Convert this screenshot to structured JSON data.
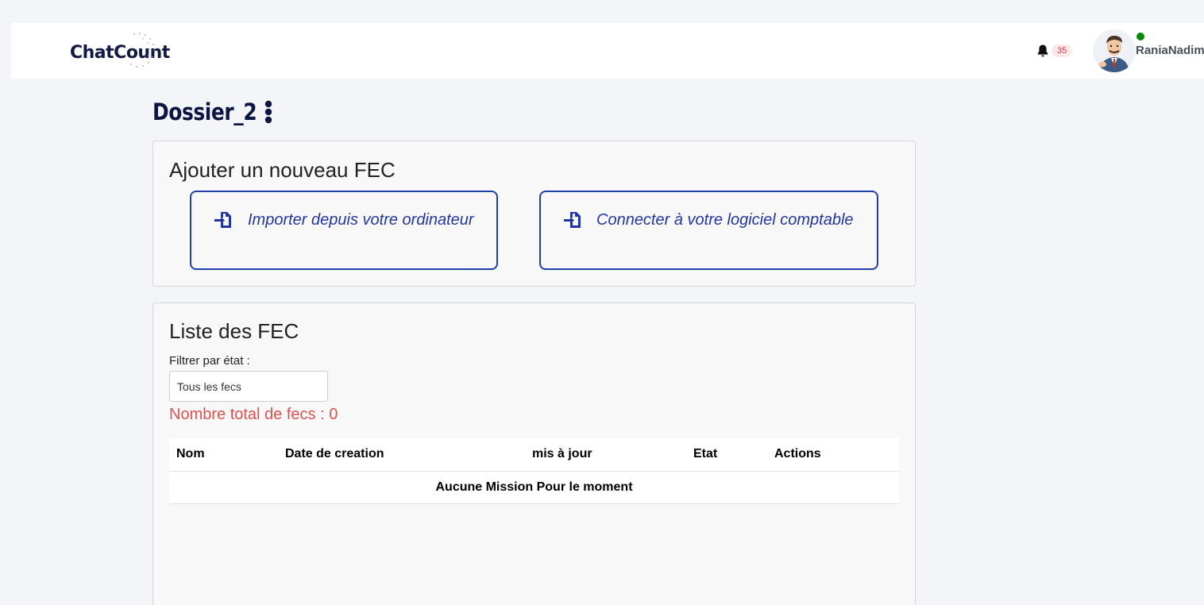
{
  "header": {
    "logo_text": "ChatCount",
    "notification_count": "35",
    "user_name": "RaniaNadim"
  },
  "page": {
    "title": "Dossier_2"
  },
  "import_card": {
    "title": "Ajouter un nouveau FEC",
    "buttons": [
      {
        "label": "Importer depuis votre ordinateur",
        "icon": "file-import-icon"
      },
      {
        "label": "Connecter à votre logiciel comptable",
        "icon": "file-import-icon"
      }
    ]
  },
  "list_card": {
    "title": "Liste des FEC",
    "filter_label": "Filtrer par état :",
    "filter_value": "Tous les fecs",
    "total_text": "Nombre total de fecs : 0",
    "columns": [
      "Nom",
      "Date de creation",
      "mis à jour",
      "Etat",
      "Actions"
    ],
    "empty_message": "Aucune Mission Pour le moment"
  },
  "colors": {
    "brand_navy": "#121a44",
    "accent_blue": "#1f3fa8",
    "danger_red": "#d9534f",
    "online_green": "#0a8a0a"
  }
}
